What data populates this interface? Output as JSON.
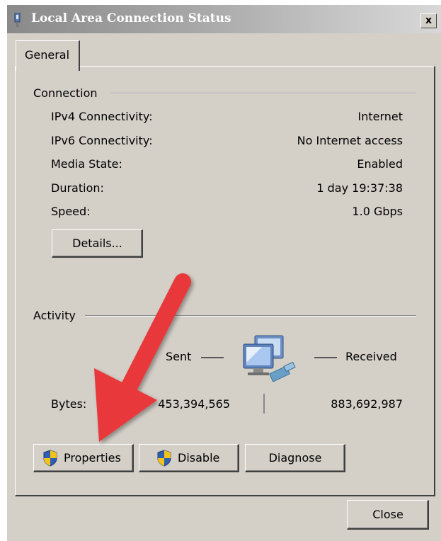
{
  "window": {
    "title": "Local Area Connection Status",
    "close_glyph": "x"
  },
  "tabs": [
    {
      "label": "General",
      "selected": true
    }
  ],
  "connection": {
    "group_label": "Connection",
    "rows": [
      {
        "label": "IPv4 Connectivity:",
        "value": "Internet"
      },
      {
        "label": "IPv6 Connectivity:",
        "value": "No Internet access"
      },
      {
        "label": "Media State:",
        "value": "Enabled"
      },
      {
        "label": "Duration:",
        "value": "1 day 19:37:38"
      },
      {
        "label": "Speed:",
        "value": "1.0 Gbps"
      }
    ],
    "details_button": "Details..."
  },
  "activity": {
    "group_label": "Activity",
    "sent_label": "Sent",
    "received_label": "Received",
    "bytes_label": "Bytes:",
    "bytes_sent": "453,394,565",
    "bytes_received": "883,692,987",
    "icon": "network-computers-icon"
  },
  "buttons": {
    "properties": "Properties",
    "disable": "Disable",
    "diagnose": "Diagnose",
    "close": "Close"
  },
  "annotation": {
    "icon": "red-arrow-icon",
    "color": "#e8383a"
  },
  "colors": {
    "dialog_bg": "#d4d0c8",
    "titlebar": "#9a9a9a"
  }
}
